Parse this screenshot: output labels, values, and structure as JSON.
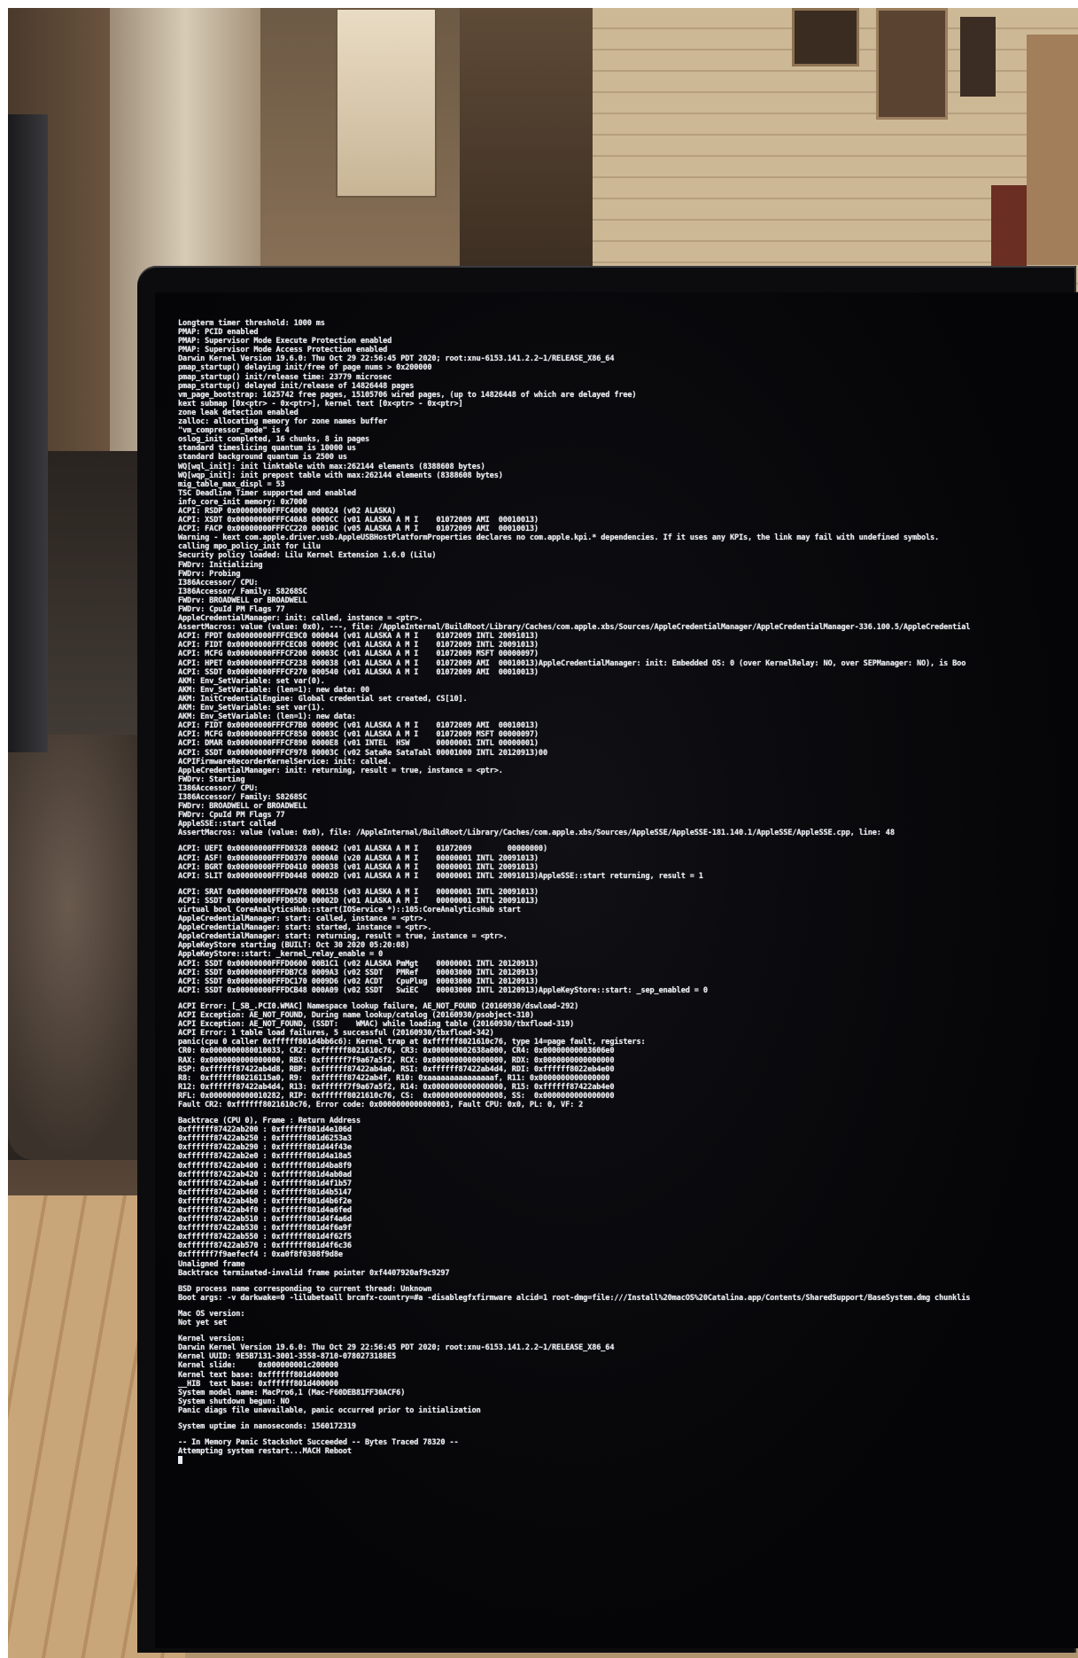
{
  "terminal": {
    "block1": [
      "Longterm timer threshold: 1000 ms",
      "PMAP: PCID enabled",
      "PMAP: Supervisor Mode Execute Protection enabled",
      "PMAP: Supervisor Mode Access Protection enabled",
      "Darwin Kernel Version 19.6.0: Thu Oct 29 22:56:45 PDT 2020; root:xnu-6153.141.2.2~1/RELEASE_X86_64",
      "pmap_startup() delaying init/free of page nums > 0x200000",
      "pmap_startup() init/release time: 23779 microsec",
      "pmap_startup() delayed init/release of 14826448 pages",
      "vm_page_bootstrap: 1625742 free pages, 15105706 wired pages, (up to 14826448 of which are delayed free)",
      "kext submap [0x<ptr> - 0x<ptr>], kernel text [0x<ptr> - 0x<ptr>]",
      "zone leak detection enabled",
      "zalloc: allocating memory for zone names buffer",
      "\"vm_compressor_mode\" is 4",
      "oslog_init completed, 16 chunks, 8 in pages",
      "standard timeslicing quantum is 10000 us",
      "standard background quantum is 2500 us",
      "WQ[wql_init]: init linktable with max:262144 elements (8388608 bytes)",
      "WQ[wqp_init]: init prepost table with max:262144 elements (8388608 bytes)",
      "mig_table_max_displ = 53",
      "TSC Deadline Timer supported and enabled",
      "info_core_init memory: 0x7000",
      "ACPI: RSDP 0x00000000FFFC4000 000024 (v02 ALASKA)",
      "ACPI: XSDT 0x00000000FFFC40A8 0000CC (v01 ALASKA A M I    01072009 AMI  00010013)",
      "ACPI: FACP 0x00000000FFFCC220 00010C (v05 ALASKA A M I    01072009 AMI  00010013)",
      "Warning - kext com.apple.driver.usb.AppleUSBHostPlatformProperties declares no com.apple.kpi.* dependencies. If it uses any KPIs, the link may fail with undefined symbols.",
      "calling mpo_policy_init for Lilu",
      "Security policy loaded: Lilu Kernel Extension 1.6.0 (Lilu)",
      "FWDrv: Initializing",
      "FWDrv: Probing",
      "I386Accessor/ CPU:",
      "I386Accessor/ Family: S8268SC",
      "FWDrv: BROADWELL or BROADWELL",
      "FWDrv: CpuId PM Flags 77",
      "AppleCredentialManager: init: called, instance = <ptr>.",
      "AssertMacros: value (value: 0x0), ---, file: /AppleInternal/BuildRoot/Library/Caches/com.apple.xbs/Sources/AppleCredentialManager/AppleCredentialManager-336.100.5/AppleCredential",
      "ACPI: FPDT 0x00000000FFFCE9C0 000044 (v01 ALASKA A M I    01072009 INTL 20091013)",
      "ACPI: FIDT 0x00000000FFFCEC08 00009C (v01 ALASKA A M I    01072009 INTL 20091013)",
      "ACPI: MCFG 0x00000000FFFCF200 00003C (v01 ALASKA A M I    01072009 MSFT 00000097)",
      "ACPI: HPET 0x00000000FFFCF238 000038 (v01 ALASKA A M I    01072009 AMI  00010013)AppleCredentialManager: init: Embedded OS: 0 (over KernelRelay: NO, over SEPManager: NO), is Boo",
      "ACPI: SSDT 0x00000000FFFCF270 000540 (v01 ALASKA A M I    01072009 AMI  00010013)",
      "AKM: Env_SetVariable: set var(0).",
      "AKM: Env_SetVariable: (len=1): new data: 00",
      "AKM: InitCredentialEngine: Global credential set created, CS[10].",
      "AKM: Env_SetVariable: set var(1).",
      "AKM: Env_SetVariable: (len=1): new data:",
      "ACPI: FIDT 0x00000000FFFCF7B0 00009C (v01 ALASKA A M I    01072009 AMI  00010013)",
      "ACPI: MCFG 0x00000000FFFCF850 00003C (v01 ALASKA A M I    01072009 MSFT 00000097)",
      "ACPI: DMAR 0x00000000FFFCF890 0000E8 (v01 INTEL  HSW      00000001 INTL 00000001)",
      "ACPI: SSDT 0x00000000FFFCF978 00003C (v02 SataRe SataTabl 00001000 INTL 20120913)00",
      "ACPIFirmwareRecorderKernelService: init: called.",
      "AppleCredentialManager: init: returning, result = true, instance = <ptr>.",
      "FWDrv: Starting",
      "I386Accessor/ CPU:",
      "I386Accessor/ Family: S8268SC",
      "FWDrv: BROADWELL or BROADWELL",
      "FWDrv: CpuId PM Flags 77",
      "AppleSSE::start called",
      "AssertMacros: value (value: 0x0), file: /AppleInternal/BuildRoot/Library/Caches/com.apple.xbs/Sources/AppleSSE/AppleSSE-181.140.1/AppleSSE/AppleSSE.cpp, line: 48"
    ],
    "block2": [
      "ACPI: UEFI 0x00000000FFFD0328 000042 (v01 ALASKA A M I    01072009        00000000)",
      "ACPI: ASF! 0x00000000FFFD0370 0000A0 (v20 ALASKA A M I    00000001 INTL 20091013)",
      "ACPI: BGRT 0x00000000FFFD0410 000038 (v01 ALASKA A M I    00000001 INTL 20091013)",
      "ACPI: SLIT 0x00000000FFFD0448 00002D (v01 ALASKA A M I    00000001 INTL 20091013)AppleSSE::start returning, result = 1"
    ],
    "block3": [
      "ACPI: SRAT 0x00000000FFFD0478 000158 (v03 ALASKA A M I    00000001 INTL 20091013)",
      "ACPI: SSDT 0x00000000FFFD05D0 00002D (v01 ALASKA A M I    00000001 INTL 20091013)",
      "virtual bool CoreAnalyticsHub::start(IOService *)::105:CoreAnalyticsHub start",
      "AppleCredentialManager: start: called, instance = <ptr>.",
      "AppleCredentialManager: start: started, instance = <ptr>.",
      "AppleCredentialManager: start: returning, result = true, instance = <ptr>.",
      "AppleKeyStore starting (BUILT: Oct 30 2020 05:20:08)",
      "AppleKeyStore::start: _kernel_relay_enable = 0",
      "ACPI: SSDT 0x00000000FFFD0600 00B1C1 (v02 ALASKA PmMgt    00000001 INTL 20120913)",
      "ACPI: SSDT 0x00000000FFFDB7C8 0009A3 (v02 SSDT   PMRef    00003000 INTL 20120913)",
      "ACPI: SSDT 0x00000000FFFDC170 0009D6 (v02 ACDT   CpuPlug  00003000 INTL 20120913)",
      "ACPI: SSDT 0x00000000FFFDCB48 000A09 (v02 SSDT   SwiEC    00003000 INTL 20120913)AppleKeyStore::start: _sep_enabled = 0"
    ],
    "block4": [
      "ACPI Error: [_SB_.PCI0.WMAC] Namespace lookup failure, AE_NOT_FOUND (20160930/dswload-292)",
      "ACPI Exception: AE_NOT_FOUND, During name lookup/catalog (20160930/psobject-310)",
      "ACPI Exception: AE_NOT_FOUND, (SSDT:    WMAC) while loading table (20160930/tbxfload-319)",
      "ACPI Error: 1 table load failures, 5 successful (20160930/tbxfload-342)",
      "panic(cpu 0 caller 0xffffff801d4bb6c6): Kernel trap at 0xffffff8021610c76, type 14=page fault, registers:",
      "CR0: 0x0000000080010033, CR2: 0xffffff8021610c76, CR3: 0x000000002638a000, CR4: 0x00000000003606e0",
      "RAX: 0x0000000000000000, RBX: 0xffffff7f9a67a5f2, RCX: 0x0000000000000000, RDX: 0x0000000000000000",
      "RSP: 0xffffff87422ab4d8, RBP: 0xffffff87422ab4a0, RSI: 0xffffff87422ab4d4, RDI: 0xffffff8022eb4e00",
      "R8:  0xffffff80216115a0, R9:  0xffffff87422ab4f, R10: 0xaaaaaaaaaaaaaaaf, R11: 0x0000000000000000",
      "R12: 0xffffff87422ab4d4, R13: 0xffffff7f9a67a5f2, R14: 0x0000000000000000, R15: 0xffffff87422ab4e0",
      "RFL: 0x0000000000010282, RIP: 0xffffff8021610c76, CS:  0x0000000000000008, SS:  0x0000000000000000",
      "Fault CR2: 0xffffff8021610c76, Error code: 0x0000000000000003, Fault CPU: 0x0, PL: 0, VF: 2"
    ],
    "block5": [
      "Backtrace (CPU 0), Frame : Return Address",
      "0xffffff87422ab200 : 0xffffff801d4e106d",
      "0xffffff87422ab250 : 0xffffff801d6253a3",
      "0xffffff87422ab290 : 0xffffff801d44f43e",
      "0xffffff87422ab2e0 : 0xffffff801d4a18a5",
      "0xffffff87422ab400 : 0xffffff801d4ba8f9",
      "0xffffff87422ab420 : 0xffffff801d4ab0ad",
      "0xffffff87422ab4a0 : 0xffffff801d4f1b57",
      "0xffffff87422ab460 : 0xffffff801d4b5147",
      "0xffffff87422ab4b0 : 0xffffff801d4b6f2e",
      "0xffffff87422ab4f0 : 0xffffff801d4a6fed",
      "0xffffff87422ab510 : 0xffffff801d4f4a6d",
      "0xffffff87422ab530 : 0xffffff801d4f6a9f",
      "0xffffff87422ab550 : 0xffffff801d4f62f5",
      "0xffffff87422ab570 : 0xffffff801d4f6c36",
      "0xffffff7f9aefecf4 : 0xa0f8f0308f9d8e",
      "Unaligned frame",
      "Backtrace terminated-invalid frame pointer 0xf4407920af9c9297"
    ],
    "block6": [
      "BSD process name corresponding to current thread: Unknown",
      "Boot args: -v darkwake=0 -lilubetaall brcmfx-country=#a -disablegfxfirmware alcid=1 root-dmg=file:///Install%20macOS%20Catalina.app/Contents/SharedSupport/BaseSystem.dmg chunklis"
    ],
    "block7": [
      "Mac OS version:",
      "Not yet set"
    ],
    "block8": [
      "Kernel version:",
      "Darwin Kernel Version 19.6.0: Thu Oct 29 22:56:45 PDT 2020; root:xnu-6153.141.2.2~1/RELEASE_X86_64",
      "Kernel UUID: 9E5B7131-3001-3558-8710-0780273188E5",
      "Kernel slide:     0x000000001c200000",
      "Kernel text base: 0xffffff801d400000",
      "__HIB  text base: 0xffffff801d400000",
      "System model name: MacPro6,1 (Mac-F60DEB81FF30ACF6)",
      "System shutdown begun: NO",
      "Panic diags file unavailable, panic occurred prior to initialization"
    ],
    "block9": [
      "System uptime in nanoseconds: 1560172319"
    ],
    "block10": [
      "-- In Memory Panic Stackshot Succeeded -- Bytes Traced 78320 --",
      "Attempting system restart...MACH Reboot"
    ]
  }
}
